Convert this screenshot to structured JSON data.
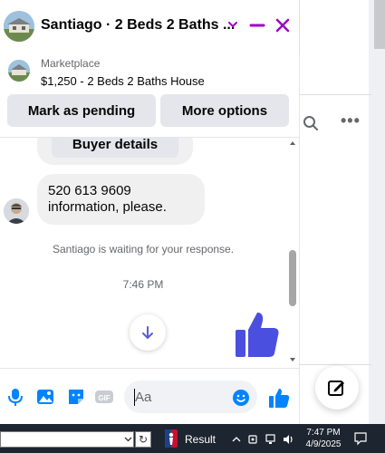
{
  "chat": {
    "title": "Santiago · 2 Beds 2 Baths ...",
    "listing_source": "Marketplace",
    "listing_title": "$1,250 - 2 Beds 2 Baths House",
    "mark_pending_label": "Mark as pending",
    "more_options_label": "More options",
    "buyer_details_label": "Buyer details",
    "message_line1": "520 613 9609",
    "message_line2": "information, please.",
    "waiting_text": "Santiago is waiting for your response.",
    "timestamp": "7:46 PM",
    "composer_placeholder": "Aa",
    "accent_color": "#0084ff",
    "header_accent": "#a000c8"
  },
  "taskbar": {
    "app_label": "Result",
    "time": "7:47 PM",
    "date": "4/9/2025"
  }
}
